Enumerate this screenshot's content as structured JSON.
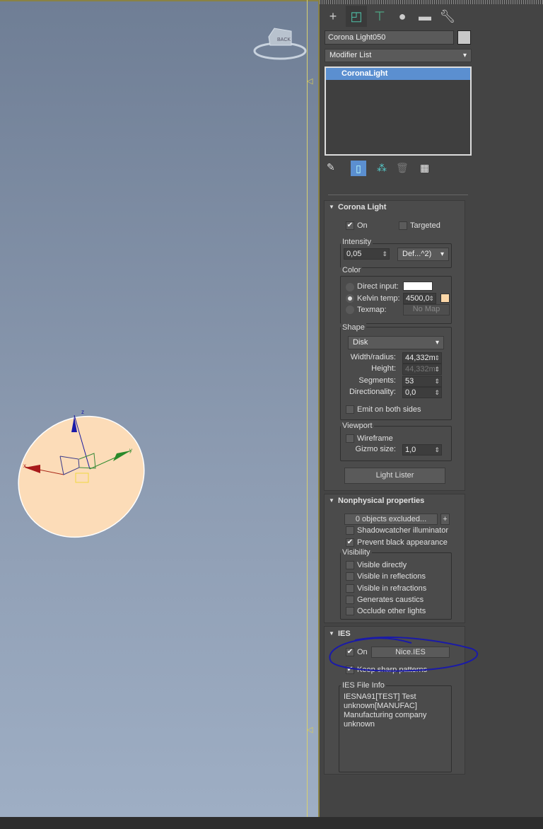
{
  "viewport": {
    "gizmo_label": "BACK",
    "axis_labels": {
      "x": "x",
      "y": "y",
      "z": "z"
    }
  },
  "command_panel": {
    "tabs": [
      "create",
      "modify",
      "hierarchy",
      "motion",
      "display",
      "utilities"
    ],
    "object_name": "Corona Light050",
    "modifier_list": "Modifier List",
    "stack_items": [
      "CoronaLight"
    ]
  },
  "corona_light": {
    "title": "Corona Light",
    "on": {
      "label": "On",
      "checked": true
    },
    "targeted": {
      "label": "Targeted",
      "checked": false
    },
    "intensity": {
      "label": "Intensity",
      "value": "0,05",
      "unit": "Def...^2)"
    },
    "color": {
      "label": "Color",
      "direct_input": "Direct input:",
      "kelvin_temp": "Kelvin temp:",
      "kelvin_value": "4500,0",
      "texmap": "Texmap:",
      "texmap_value": "No Map",
      "selected": "kelvin",
      "kelvin_swatch": "#fcd7a8",
      "direct_swatch": "#ffffff"
    },
    "shape": {
      "label": "Shape",
      "type": "Disk",
      "width_label": "Width/radius:",
      "width": "44,332m",
      "height_label": "Height:",
      "height": "44,332m",
      "segments_label": "Segments:",
      "segments": "53",
      "directionality_label": "Directionality:",
      "directionality": "0,0",
      "emit_both": "Emit on both sides"
    },
    "viewport": {
      "label": "Viewport",
      "wireframe": "Wireframe",
      "gizmo_label": "Gizmo size:",
      "gizmo_size": "1,0"
    },
    "light_lister": "Light Lister"
  },
  "nonphysical": {
    "title": "Nonphysical properties",
    "excluded": "0 objects excluded...",
    "add": "+",
    "shadowcatcher": {
      "label": "Shadowcatcher illuminator",
      "checked": false
    },
    "prevent_black": {
      "label": "Prevent black appearance",
      "checked": true
    },
    "visibility_label": "Visibility",
    "visibility": [
      {
        "label": "Visible directly",
        "checked": false
      },
      {
        "label": "Visible in reflections",
        "checked": false
      },
      {
        "label": "Visible in refractions",
        "checked": false
      },
      {
        "label": "Generates caustics",
        "checked": false
      },
      {
        "label": "Occlude other lights",
        "checked": false
      }
    ]
  },
  "ies": {
    "title": "IES",
    "on": {
      "label": "On",
      "checked": true
    },
    "file": "Nice.IES",
    "keep_sharp": {
      "label": "Keep sharp patterns",
      "checked": true
    },
    "info_label": "IES File Info",
    "info_lines": [
      "IESNA91[TEST]     Test",
      "unknown[MANUFAC]",
      "Manufacturing company",
      "unknown"
    ]
  },
  "colors": {
    "accent": "#5b8fd0",
    "annotation": "#1a1aa8",
    "light_disk": "#fcdcb8"
  }
}
